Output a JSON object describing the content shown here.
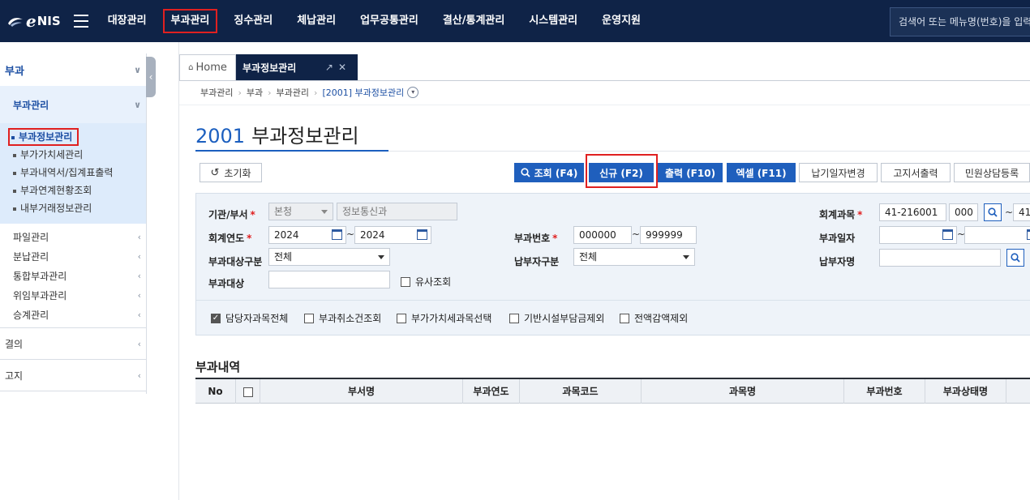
{
  "app": {
    "logo_text": "NIS",
    "logo_e": "e"
  },
  "topnav": {
    "items": [
      "대장관리",
      "부과관리",
      "징수관리",
      "체납관리",
      "업무공통관리",
      "결산/통계관리",
      "시스템관리",
      "운영지원"
    ],
    "active_index": 1,
    "search_placeholder": "검색어 또는 메뉴명(번호)을 입력"
  },
  "sidebar": {
    "top_label": "부과",
    "sub_label": "부과관리",
    "leafs": [
      "부과정보관리",
      "부가가치세관리",
      "부과내역서/집계표출력",
      "부과연계현황조회",
      "내부거래정보관리"
    ],
    "active_leaf": 0,
    "items": [
      "파일관리",
      "분납관리",
      "통합부과관리",
      "위임부과관리",
      "승계관리"
    ],
    "bottom": [
      "결의",
      "고지"
    ]
  },
  "tabs": {
    "home": "Home",
    "active": "부과정보관리"
  },
  "breadcrumb": [
    "부과관리",
    "부과",
    "부과관리",
    "[2001] 부과정보관리"
  ],
  "page": {
    "number": "2001",
    "title": "부과정보관리"
  },
  "buttons": {
    "reset": "초기화",
    "search": "조회 (F4)",
    "new": "신규 (F2)",
    "print": "출력 (F10)",
    "excel": "엑셀 (F11)",
    "due_change": "납기일자변경",
    "notice_print": "고지서출력",
    "complaint": "민원상담등록"
  },
  "form": {
    "org_label": "기관/부서",
    "org_value": "본청",
    "dept_value": "정보통신과",
    "account_label": "회계과목",
    "account_code": "41-216001",
    "account_sub": "000",
    "account_code_to": "41-",
    "year_label": "회계연도",
    "year_from": "2024",
    "year_to": "2024",
    "levy_no_label": "부과번호",
    "levy_no_from": "000000",
    "levy_no_to": "999999",
    "levy_date_label": "부과일자",
    "levy_date_from": "",
    "levy_date_to": "",
    "target_type_label": "부과대상구분",
    "target_type_value": "전체",
    "payer_type_label": "납부자구분",
    "payer_type_value": "전체",
    "payer_name_label": "납부자명",
    "payer_name_value": "",
    "target_label": "부과대상",
    "target_value": "",
    "similar_label": "유사조회",
    "tilde": "~"
  },
  "options": [
    {
      "label": "담당자과목전체",
      "checked": true
    },
    {
      "label": "부과취소건조회",
      "checked": false
    },
    {
      "label": "부가가치세과목선택",
      "checked": false
    },
    {
      "label": "기반시설부담금제외",
      "checked": false
    },
    {
      "label": "전액감액제외",
      "checked": false
    }
  ],
  "grid": {
    "title": "부과내역",
    "columns": [
      "No",
      "",
      "부서명",
      "부과연도",
      "과목코드",
      "과목명",
      "부과번호",
      "부과상태명"
    ]
  },
  "colors": {
    "nav_bg": "#0f2347",
    "primary": "#1f5fbd",
    "highlight": "#e02020",
    "panel_bg": "#eef3f9"
  }
}
